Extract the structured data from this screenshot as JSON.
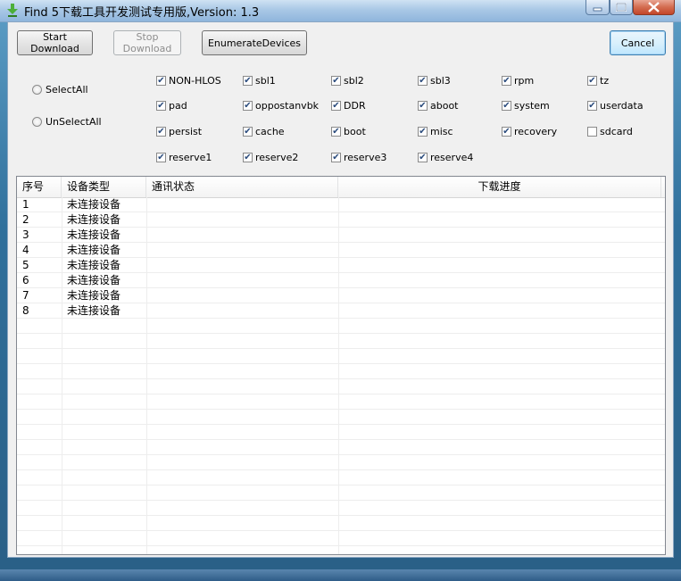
{
  "window": {
    "title": "Find 5下载工具开发测试专用版,Version: 1.3"
  },
  "toolbar": {
    "start_label": "Start Download",
    "stop_label": "Stop Download",
    "enumerate_label": "EnumerateDevices",
    "cancel_label": "Cancel"
  },
  "radios": {
    "select_all": "SelectAll",
    "unselect_all": "UnSelectAll"
  },
  "partitions": [
    {
      "label": "NON-HLOS",
      "checked": true
    },
    {
      "label": "sbl1",
      "checked": true
    },
    {
      "label": "sbl2",
      "checked": true
    },
    {
      "label": "sbl3",
      "checked": true
    },
    {
      "label": "rpm",
      "checked": true
    },
    {
      "label": "tz",
      "checked": true
    },
    {
      "label": "pad",
      "checked": true
    },
    {
      "label": "oppostanvbk",
      "checked": true
    },
    {
      "label": "DDR",
      "checked": true
    },
    {
      "label": "aboot",
      "checked": true
    },
    {
      "label": "system",
      "checked": true
    },
    {
      "label": "userdata",
      "checked": true
    },
    {
      "label": "persist",
      "checked": true
    },
    {
      "label": "cache",
      "checked": true
    },
    {
      "label": "boot",
      "checked": true
    },
    {
      "label": "misc",
      "checked": true
    },
    {
      "label": "recovery",
      "checked": true
    },
    {
      "label": "sdcard",
      "checked": false
    },
    {
      "label": "reserve1",
      "checked": true
    },
    {
      "label": "reserve2",
      "checked": true
    },
    {
      "label": "reserve3",
      "checked": true
    },
    {
      "label": "reserve4",
      "checked": true
    }
  ],
  "table": {
    "columns": [
      "序号",
      "设备类型",
      "通讯状态",
      "下载进度"
    ],
    "rows": [
      {
        "index": "1",
        "device": "未连接设备",
        "status": "",
        "progress": ""
      },
      {
        "index": "2",
        "device": "未连接设备",
        "status": "",
        "progress": ""
      },
      {
        "index": "3",
        "device": "未连接设备",
        "status": "",
        "progress": ""
      },
      {
        "index": "4",
        "device": "未连接设备",
        "status": "",
        "progress": ""
      },
      {
        "index": "5",
        "device": "未连接设备",
        "status": "",
        "progress": ""
      },
      {
        "index": "6",
        "device": "未连接设备",
        "status": "",
        "progress": ""
      },
      {
        "index": "7",
        "device": "未连接设备",
        "status": "",
        "progress": ""
      },
      {
        "index": "8",
        "device": "未连接设备",
        "status": "",
        "progress": ""
      }
    ]
  },
  "icons": {
    "app": "download-arrow-icon",
    "minimize": "minimize-icon",
    "maximize": "maximize-icon",
    "close": "close-icon"
  }
}
